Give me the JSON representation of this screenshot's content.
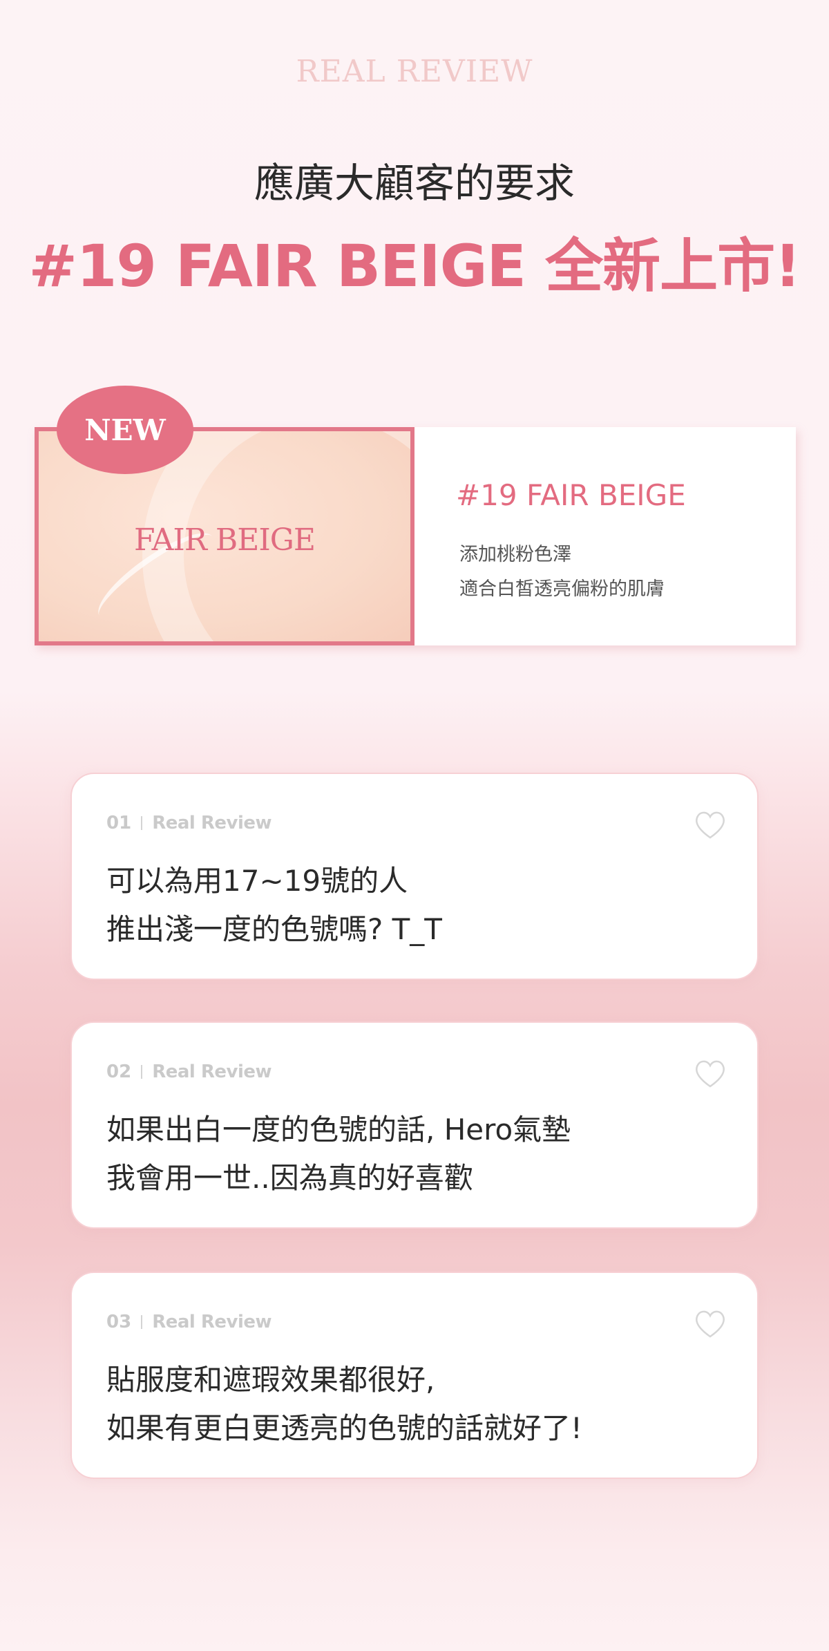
{
  "header": {
    "label": "REAL REVIEW",
    "subtitle": "應廣大顧客的要求",
    "headline": "#19 FAIR BEIGE 全新上市!"
  },
  "product": {
    "badge": "NEW",
    "swatch_label": "FAIR BEIGE",
    "name": "#19 FAIR BEIGE",
    "desc_line1": "添加桃粉色澤",
    "desc_line2": "適合白皙透亮偏粉的肌膚"
  },
  "reviews": [
    {
      "num": "01",
      "tag": "Real Review",
      "line1": "可以為用17~19號的人",
      "line2": "推出淺一度的色號嗎? T_T",
      "icon": "heart-icon"
    },
    {
      "num": "02",
      "tag": "Real Review",
      "line1": "如果出白一度的色號的話, Hero氣墊",
      "line2": "我會用一世..因為真的好喜歡",
      "icon": "heart-icon"
    },
    {
      "num": "03",
      "tag": "Real Review",
      "line1": "貼服度和遮瑕效果都很好,",
      "line2": "如果有更白更透亮的色號的話就好了!",
      "icon": "heart-icon"
    }
  ],
  "colors": {
    "accent": "#e36b80",
    "header_label": "#f1c9c9",
    "swatch_border": "#e27889",
    "badge": "#e57184"
  }
}
